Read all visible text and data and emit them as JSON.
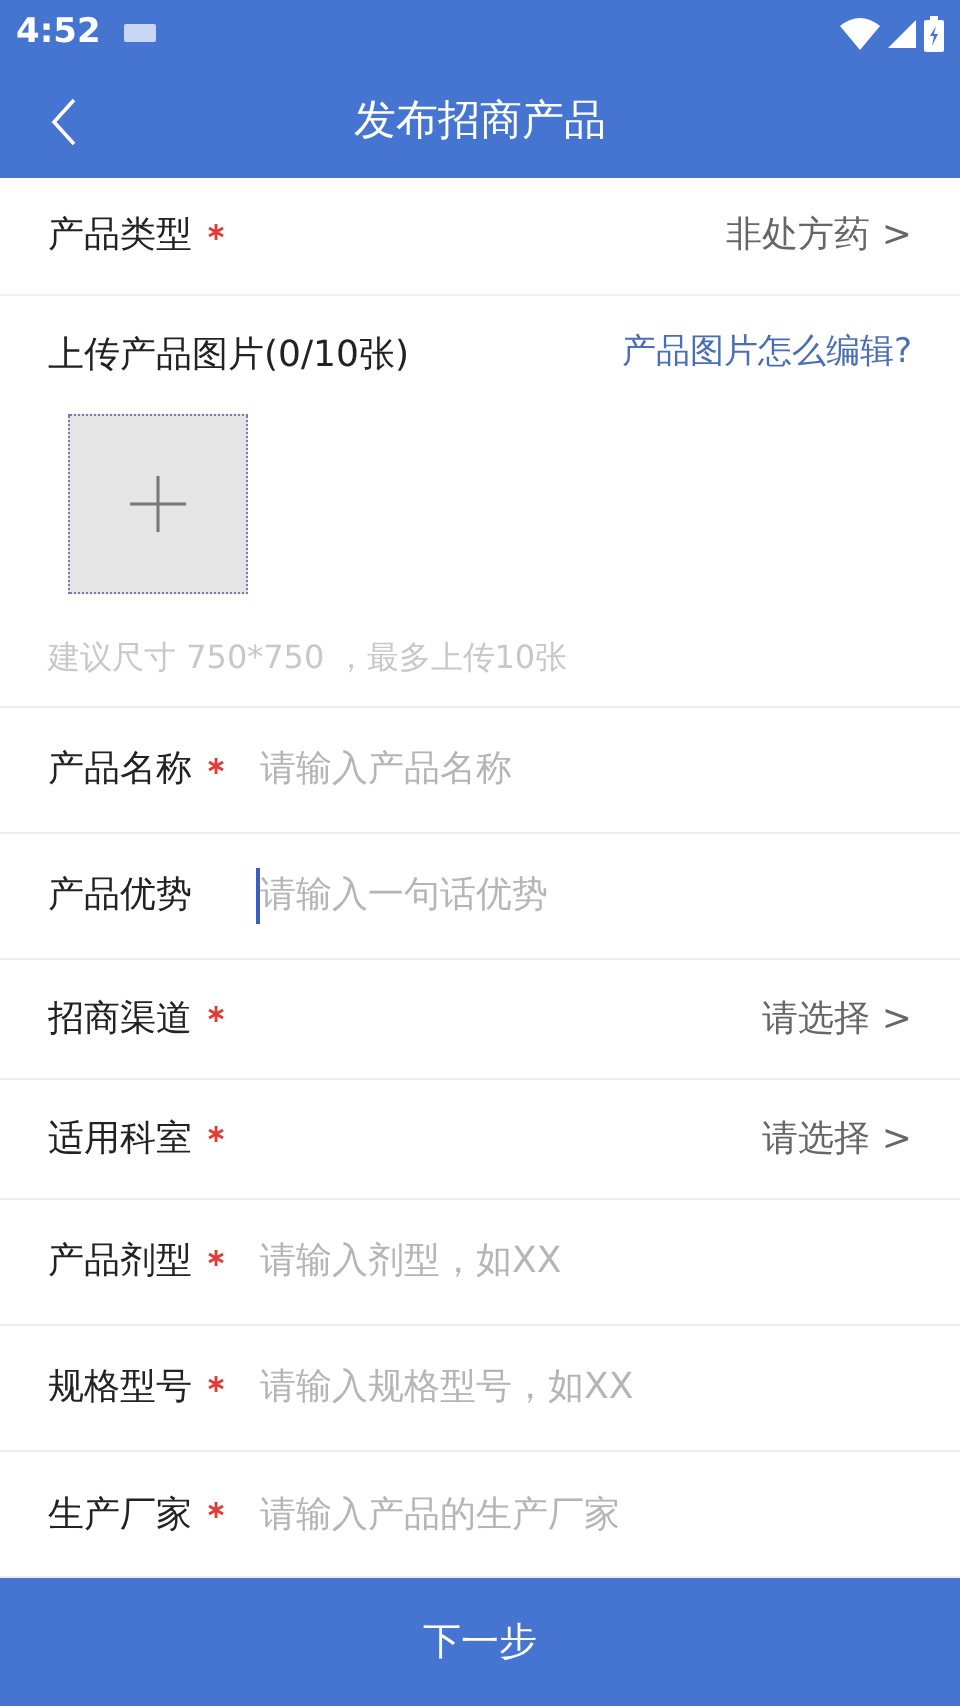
{
  "status_bar": {
    "time": "4:52"
  },
  "header": {
    "title": "发布招商产品"
  },
  "product_type": {
    "label": "产品类型",
    "required": true,
    "value": "非处方药 >"
  },
  "upload": {
    "label": "上传产品图片(0/10张)",
    "help_link": "产品图片怎么编辑?",
    "hint": "建议尺寸 750*750 ，最多上传10张"
  },
  "fields": [
    {
      "kind": "input",
      "label": "产品名称",
      "required": true,
      "placeholder": "请输入产品名称",
      "focused": false
    },
    {
      "kind": "input",
      "label": "产品优势",
      "required": false,
      "placeholder": "请输入一句话优势",
      "focused": true
    },
    {
      "kind": "select",
      "label": "招商渠道",
      "required": true,
      "value": "请选择 >"
    },
    {
      "kind": "select",
      "label": "适用科室",
      "required": true,
      "value": "请选择 >"
    },
    {
      "kind": "input",
      "label": "产品剂型",
      "required": true,
      "placeholder": "请输入剂型，如XX",
      "focused": false
    },
    {
      "kind": "input",
      "label": "规格型号",
      "required": true,
      "placeholder": "请输入规格型号，如XX",
      "focused": false
    },
    {
      "kind": "input",
      "label": "生产厂家",
      "required": true,
      "placeholder": "请输入产品的生产厂家",
      "focused": false
    }
  ],
  "next_button": "下一步"
}
